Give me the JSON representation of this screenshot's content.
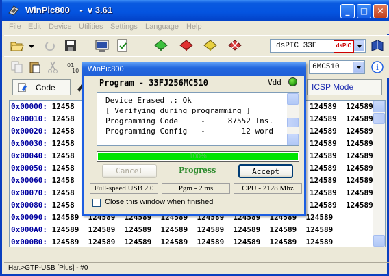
{
  "app": {
    "title": "WinPic800    -  v 3.61",
    "menu": [
      "File",
      "Edit",
      "Device",
      "Utilities",
      "Settings",
      "Language",
      "Help"
    ]
  },
  "toolbar": {
    "device_combo": "dsPIC 33F",
    "device_logo": "dsPIC",
    "chip_combo": "6MC510"
  },
  "tabs": {
    "code": "Code",
    "icsp": "ICSP Mode"
  },
  "hex": {
    "rows": [
      {
        "addr": "0x00000:",
        "left": "12458",
        "right": "124589  124589"
      },
      {
        "addr": "0x00010:",
        "left": "12458",
        "right": "124589  124589"
      },
      {
        "addr": "0x00020:",
        "left": "12458",
        "right": "124589  124589"
      },
      {
        "addr": "0x00030:",
        "left": "12458",
        "right": "124589  124589"
      },
      {
        "addr": "0x00040:",
        "left": "12458",
        "right": "124589  124589"
      },
      {
        "addr": "0x00050:",
        "left": "12458",
        "right": "124589  124589"
      },
      {
        "addr": "0x00060:",
        "left": "12458",
        "right": "124589  124589"
      },
      {
        "addr": "0x00070:",
        "left": "12458",
        "right": "124589  124589"
      },
      {
        "addr": "0x00080:",
        "left": "12458",
        "right": "124589  124589"
      },
      {
        "addr": "0x00090:",
        "left": "124589  124589  124589  124589  124589  124589  124589  124589",
        "right": ""
      },
      {
        "addr": "0x000A0:",
        "left": "124589  124589  124589  124589  124589  124589  124589  124589",
        "right": ""
      },
      {
        "addr": "0x000B0:",
        "left": "124589  124589  124589  124589  124589  124589  124589  124589",
        "right": ""
      }
    ]
  },
  "status": {
    "text": "Har.>GTP-USB [Plus] - #0"
  },
  "dialog": {
    "title": "WinPic800",
    "header": "Program - 33FJ256MC510",
    "vdd": "Vdd",
    "log": [
      "Device Erased .: Ok",
      "[ Verifying during programming ]",
      "Programming Code     -     87552 Ins.",
      "Programming Config   -        12 word"
    ],
    "progress_percent": 100,
    "progress_text": "100%",
    "cancel": "Cancel",
    "progress_label": "Progress",
    "accept": "Accept",
    "info": [
      "Full-speed USB 2.0",
      "Pgm - 2 ms",
      "CPU - 2128 Mhz"
    ],
    "close_checkbox": "Close this window when finished"
  },
  "colors": {
    "title_bar": "#0454e0",
    "progress_fill": "#00e400",
    "vdd_led": "#2fbf12",
    "address": "#0000a0"
  }
}
